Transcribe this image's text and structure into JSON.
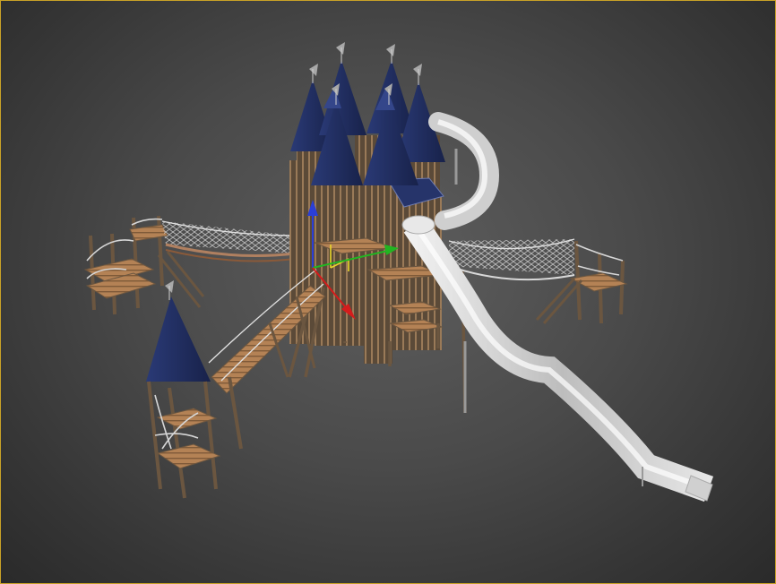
{
  "viewport": {
    "name": "perspective-viewport",
    "active_border_color": "#c9a227",
    "background_center": "#5e5e5e",
    "background_edge": "#2a2a2a"
  },
  "scene": {
    "object": "castle-playground-model",
    "colors": {
      "roof": "#1f2d5c",
      "roof_highlight": "#34468a",
      "wood_post": "#6b5640",
      "wood_deck": "#b48255",
      "slide": "#d8d8d8",
      "flag": "#9a9a9a",
      "rope": "#d0d0d0"
    }
  },
  "gizmo": {
    "x_axis_color": "#d41c1c",
    "y_axis_color": "#22b522",
    "z_axis_color": "#2b3fd6",
    "plane_color": "#e8d62a"
  }
}
